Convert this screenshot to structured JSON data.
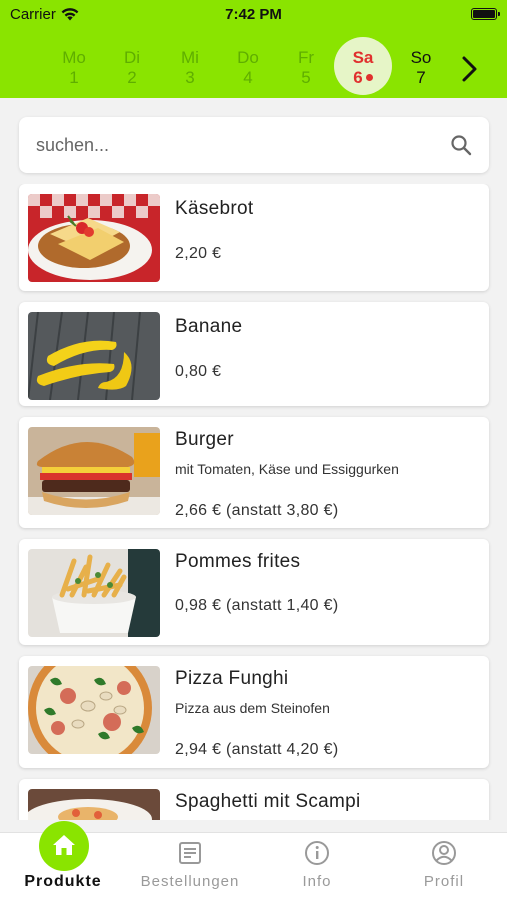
{
  "status_bar": {
    "carrier": "Carrier",
    "time": "7:42 PM"
  },
  "days": [
    {
      "name": "Mo",
      "num": "1"
    },
    {
      "name": "Di",
      "num": "2"
    },
    {
      "name": "Mi",
      "num": "3"
    },
    {
      "name": "Do",
      "num": "4"
    },
    {
      "name": "Fr",
      "num": "5"
    },
    {
      "name": "Sa",
      "num": "6",
      "selected": true
    },
    {
      "name": "So",
      "num": "7"
    }
  ],
  "search": {
    "placeholder": "suchen..."
  },
  "products": [
    {
      "name": "Käsebrot",
      "description": "",
      "price": "2,20 €",
      "image": "cheese-bread"
    },
    {
      "name": "Banane",
      "description": "",
      "price": "0,80 €",
      "image": "bananas"
    },
    {
      "name": "Burger",
      "description": "mit Tomaten, Käse und Essiggurken",
      "price": "2,66 € (anstatt 3,80 €)",
      "image": "burger"
    },
    {
      "name": "Pommes frites",
      "description": "",
      "price": "0,98 € (anstatt 1,40 €)",
      "image": "fries"
    },
    {
      "name": "Pizza Funghi",
      "description": "Pizza aus dem Steinofen",
      "price": "2,94 € (anstatt 4,20 €)",
      "image": "pizza"
    },
    {
      "name": "Spaghetti mit Scampi",
      "description": "",
      "price": "",
      "image": "spaghetti"
    }
  ],
  "nav": [
    {
      "label": "Produkte",
      "icon": "home-icon",
      "active": true
    },
    {
      "label": "Bestellungen",
      "icon": "receipt-icon"
    },
    {
      "label": "Info",
      "icon": "info-icon"
    },
    {
      "label": "Profil",
      "icon": "profile-icon"
    }
  ],
  "colors": {
    "accent": "#8ae400",
    "selected_day": "#e0302e",
    "weekday_text": "#5fae00"
  }
}
